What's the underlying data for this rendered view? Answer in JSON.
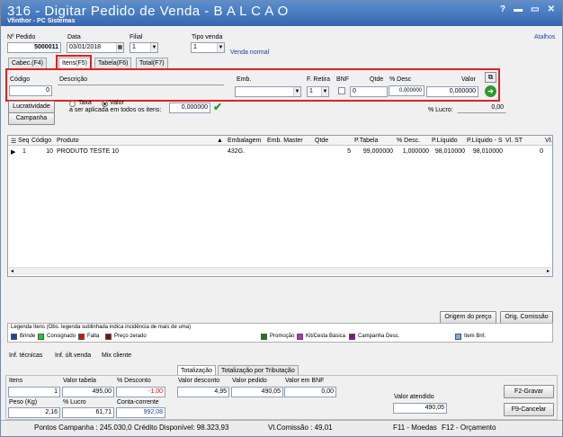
{
  "window": {
    "title": "316 - Digitar Pedido de Venda - B A L C A O",
    "subtitle": "Vfinthor - PC Sistemas",
    "help": "?",
    "minimize": "▬",
    "restore": "▭",
    "close": "✕"
  },
  "header": {
    "pedido_label": "Nº Pedido",
    "pedido_value": "5000011",
    "data_label": "Data",
    "data_value": "03/01/2018",
    "filial_label": "Filial",
    "filial_value": "1",
    "tipo_venda_label": "Tipo venda",
    "tipo_venda_value": "1",
    "tipo_venda_desc": "Venda normal",
    "atalhos": "Atalhos"
  },
  "tabs": [
    {
      "label": "Cabec.(F4)"
    },
    {
      "label": "Itens(F5)"
    },
    {
      "label": "Tabela(F6)"
    },
    {
      "label": "Total(F7)"
    }
  ],
  "item_form": {
    "codigo_label": "Código",
    "codigo_value": "0",
    "descricao_label": "Descrição",
    "descricao_value": "",
    "emb_label": "Emb.",
    "emb_value": "",
    "fretira_label": "F. Retira",
    "fretira_value": "1",
    "bnf_label": "BNF",
    "qtde_label": "Qtde",
    "qtde_value": "0",
    "desc_label": "% Desc",
    "desc_value": "0,000000",
    "valor_label": "Valor",
    "valor_value": "0,000000"
  },
  "discount": {
    "lucratividade": "Lucratividade",
    "campanha": "Campanha",
    "taxa": "Taxa",
    "valor": "Valor",
    "aplicar_label": "a ser aplicada em todos os itens:",
    "aplicar_value": "0,000000",
    "lucro_label": "% Lucro:",
    "lucro_value": "0,00"
  },
  "grid": {
    "columns": [
      "Seq",
      "Código",
      "Produto",
      "Embalagem",
      "Emb. Master",
      "Qtde",
      "P.Tabela",
      "% Desc.",
      "P.Líquido",
      "P.Líquido - S",
      "Vl. ST",
      "Vl."
    ],
    "rows": [
      {
        "seq": "1",
        "codigo": "10",
        "produto": "PRODUTO TESTE 10",
        "embalagem": "432G.",
        "emb_master": "",
        "qtde": "5",
        "p_tabela": "99,000000",
        "desc": "1,000000",
        "p_liquido": "98,010000",
        "p_liquido_s": "98,010000",
        "vl_st": "0"
      }
    ]
  },
  "buttons": {
    "origem_preco": "Origem do preço",
    "orig_comissao": "Orig. Comissão",
    "f2_gravar": "F2-Gravar",
    "f9_cancelar": "F9-Cancelar"
  },
  "legend": {
    "title": "Legenda Itens (Obs. legenda sublinhada indica incidência de mais de uma)",
    "items": [
      {
        "label": "Brinde",
        "color": "#1f3fbf"
      },
      {
        "label": "Consignado",
        "color": "#22cc22"
      },
      {
        "label": "Falta",
        "color": "#e01010"
      },
      {
        "label": "Preço zerado",
        "color": "#7a1010"
      },
      {
        "label": "Promoção",
        "color": "#1a7a1a"
      },
      {
        "label": "Kit/Cesta Básica",
        "color": "#cc22cc"
      },
      {
        "label": "Campanha Desc.",
        "color": "#881188"
      },
      {
        "label": "Item Bnf.",
        "color": "#77aaee"
      }
    ]
  },
  "info_tabs": [
    "Inf. técnicas",
    "Inf. últ.venda",
    "Mix cliente"
  ],
  "totals_tabs": [
    "Totalização",
    "Totalização por Tributação"
  ],
  "totals": {
    "itens_label": "Itens",
    "itens_value": "1",
    "valor_tabela_label": "Valor tabela",
    "valor_tabela_value": "495,00",
    "pct_desconto_label": "% Desconto",
    "pct_desconto_value": "-1,00",
    "peso_label": "Peso (Kg)",
    "peso_value": "2,16",
    "pct_lucro_label": "% Lucro",
    "pct_lucro_value": "61,71",
    "conta_corrente_label": "Conta-corrente",
    "conta_corrente_value": "992,08",
    "valor_desconto_label": "Valor desconto",
    "valor_desconto_value": "4,95",
    "valor_pedido_label": "Valor pedido",
    "valor_pedido_value": "490,05",
    "valor_bnf_label": "Valor em BNF",
    "valor_bnf_value": "0,00",
    "valor_atendido_label": "Valor atendido",
    "valor_atendido_value": "490,05"
  },
  "status": {
    "pontos": "Pontos Campanha : 245.030,0",
    "credito": "Crédito Disponível: 98.323,93",
    "comissao": "Vl.Comissão : 49,01",
    "f11": "F11 - Moedas",
    "f12": "F12 - Orçamento"
  }
}
